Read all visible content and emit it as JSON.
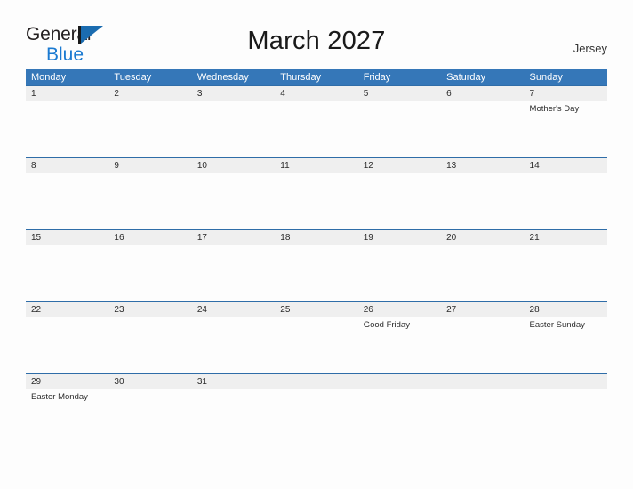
{
  "brand": {
    "word1": "General",
    "word2": "Blue",
    "flag_icon": "flag-triangle-icon",
    "accent_blue": "#1b7ad1",
    "flag_blue": "#1b6cb0"
  },
  "header": {
    "title": "March 2027",
    "region": "Jersey"
  },
  "calendar": {
    "header_bg": "#3577b8",
    "date_band_bg": "#efefef",
    "row_divider": "#2f6da8",
    "weekdays": [
      "Monday",
      "Tuesday",
      "Wednesday",
      "Thursday",
      "Friday",
      "Saturday",
      "Sunday"
    ],
    "weeks": [
      {
        "dates": [
          "1",
          "2",
          "3",
          "4",
          "5",
          "6",
          "7"
        ],
        "events": [
          "",
          "",
          "",
          "",
          "",
          "",
          "Mother's Day"
        ]
      },
      {
        "dates": [
          "8",
          "9",
          "10",
          "11",
          "12",
          "13",
          "14"
        ],
        "events": [
          "",
          "",
          "",
          "",
          "",
          "",
          ""
        ]
      },
      {
        "dates": [
          "15",
          "16",
          "17",
          "18",
          "19",
          "20",
          "21"
        ],
        "events": [
          "",
          "",
          "",
          "",
          "",
          "",
          ""
        ]
      },
      {
        "dates": [
          "22",
          "23",
          "24",
          "25",
          "26",
          "27",
          "28"
        ],
        "events": [
          "",
          "",
          "",
          "",
          "Good Friday",
          "",
          "Easter Sunday"
        ]
      },
      {
        "dates": [
          "29",
          "30",
          "31",
          "",
          "",
          "",
          ""
        ],
        "events": [
          "Easter Monday",
          "",
          "",
          "",
          "",
          "",
          ""
        ]
      }
    ]
  }
}
